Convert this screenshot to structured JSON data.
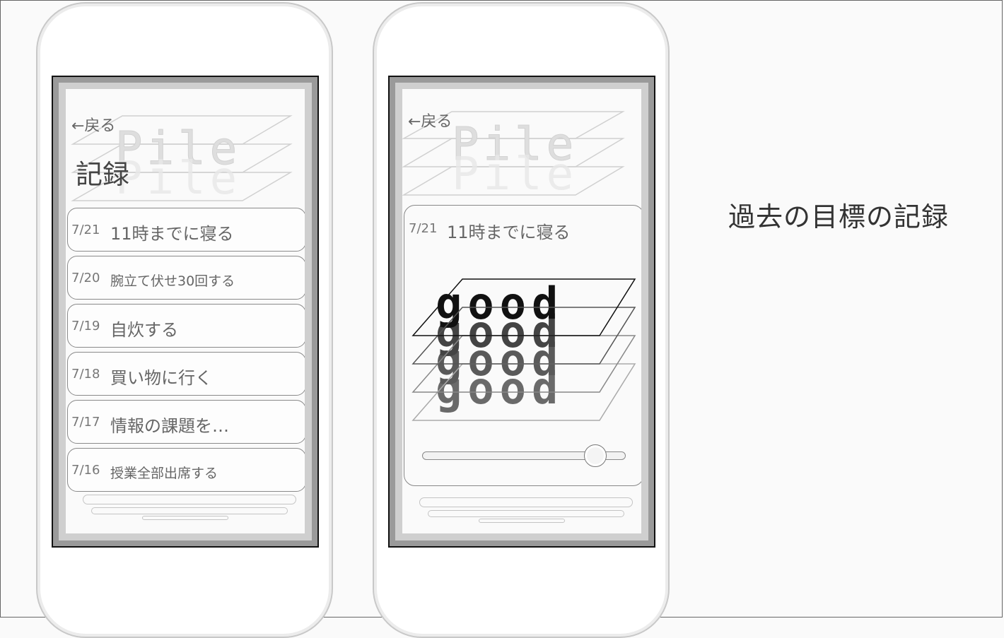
{
  "caption": "過去の目標の記録",
  "left_screen": {
    "back_label": "←戻る",
    "bg_logo": "Pile",
    "title": "記録",
    "records": [
      {
        "date": "7/21",
        "goal": "11時までに寝る"
      },
      {
        "date": "7/20",
        "goal": "腕立て伏せ30回する"
      },
      {
        "date": "7/19",
        "goal": "自炊する"
      },
      {
        "date": "7/18",
        "goal": "買い物に行く"
      },
      {
        "date": "7/17",
        "goal": "情報の課題を…"
      },
      {
        "date": "7/16",
        "goal": "授業全部出席する"
      }
    ]
  },
  "right_screen": {
    "back_label": "←戻る",
    "bg_logo": "Pile",
    "detail": {
      "date": "7/21",
      "goal": "11時までに寝る",
      "stamp_word": "good",
      "slider_value": 0.85
    }
  }
}
